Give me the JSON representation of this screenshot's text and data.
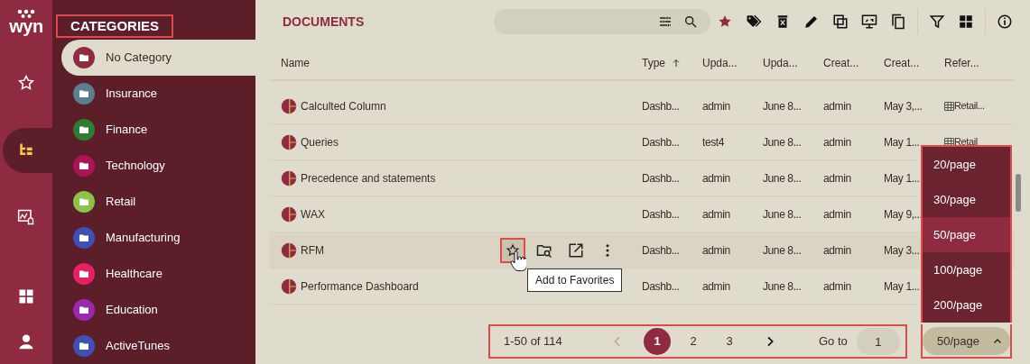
{
  "logo": {
    "text": "wyn"
  },
  "rail": [
    {
      "kind": "star",
      "selected": false
    },
    {
      "kind": "tree",
      "selected": true
    },
    {
      "kind": "alert",
      "selected": false
    },
    {
      "kind": "grid",
      "selected": false
    },
    {
      "kind": "user",
      "selected": false
    }
  ],
  "sidebar": {
    "title": "CATEGORIES",
    "items": [
      {
        "label": "No Category",
        "color": "#8f2b41",
        "selected": true
      },
      {
        "label": "Insurance",
        "color": "#5b7f8f",
        "selected": false
      },
      {
        "label": "Finance",
        "color": "#2e7d32",
        "selected": false
      },
      {
        "label": "Technology",
        "color": "#ad1457",
        "selected": false
      },
      {
        "label": "Retail",
        "color": "#8bc34a",
        "selected": false
      },
      {
        "label": "Manufacturing",
        "color": "#3f51b5",
        "selected": false
      },
      {
        "label": "Healthcare",
        "color": "#e91e63",
        "selected": false
      },
      {
        "label": "Education",
        "color": "#9c27b0",
        "selected": false
      },
      {
        "label": "ActiveTunes",
        "color": "#3f51b5",
        "selected": false
      }
    ]
  },
  "documents": {
    "title": "DOCUMENTS"
  },
  "table": {
    "columns": [
      {
        "label": "Name",
        "sorted_ascending": false
      },
      {
        "label": "Type",
        "sorted_ascending": true
      },
      {
        "label": "Upda...",
        "sorted_ascending": false
      },
      {
        "label": "Upda...",
        "sorted_ascending": false
      },
      {
        "label": "Creat...",
        "sorted_ascending": false
      },
      {
        "label": "Creat...",
        "sorted_ascending": false
      },
      {
        "label": "Refer...",
        "sorted_ascending": false
      }
    ],
    "rows": [
      {
        "cells": [
          "Calculted Column",
          "Dashb...",
          "admin",
          "June 8...",
          "admin",
          "May 3,...",
          "Retail..."
        ],
        "hovered": false
      },
      {
        "cells": [
          "Queries",
          "Dashb...",
          "test4",
          "June 8...",
          "admin",
          "May 1...",
          "Retail"
        ],
        "hovered": false
      },
      {
        "cells": [
          "Precedence and statements",
          "Dashb...",
          "admin",
          "June 8...",
          "admin",
          "May 1..."
        ],
        "hovered": false
      },
      {
        "cells": [
          "WAX",
          "Dashb...",
          "admin",
          "June 8...",
          "admin",
          "May 9,..."
        ],
        "hovered": false
      },
      {
        "cells": [
          "RFM",
          "Dashb...",
          "admin",
          "June 8...",
          "admin",
          "May 3..."
        ],
        "hovered": true
      },
      {
        "cells": [
          "Performance Dashboard",
          "Dashb...",
          "admin",
          "June 8...",
          "admin",
          "May 1..."
        ],
        "hovered": false
      }
    ]
  },
  "tooltip": {
    "text": "Add to Favorites"
  },
  "pagination": {
    "summary": "1-50 of 114",
    "prev_disabled": true,
    "pages": [
      {
        "label": "1",
        "selected": true
      },
      {
        "label": "2",
        "selected": false
      },
      {
        "label": "3",
        "selected": false
      }
    ],
    "goto_label": "Go to",
    "goto_value": "1"
  },
  "page_size": {
    "value": "50/page",
    "open": true,
    "options": [
      {
        "label": "20/page",
        "selected": false
      },
      {
        "label": "30/page",
        "selected": false
      },
      {
        "label": "50/page",
        "selected": true
      },
      {
        "label": "100/page",
        "selected": false
      },
      {
        "label": "200/page",
        "selected": false
      }
    ]
  }
}
